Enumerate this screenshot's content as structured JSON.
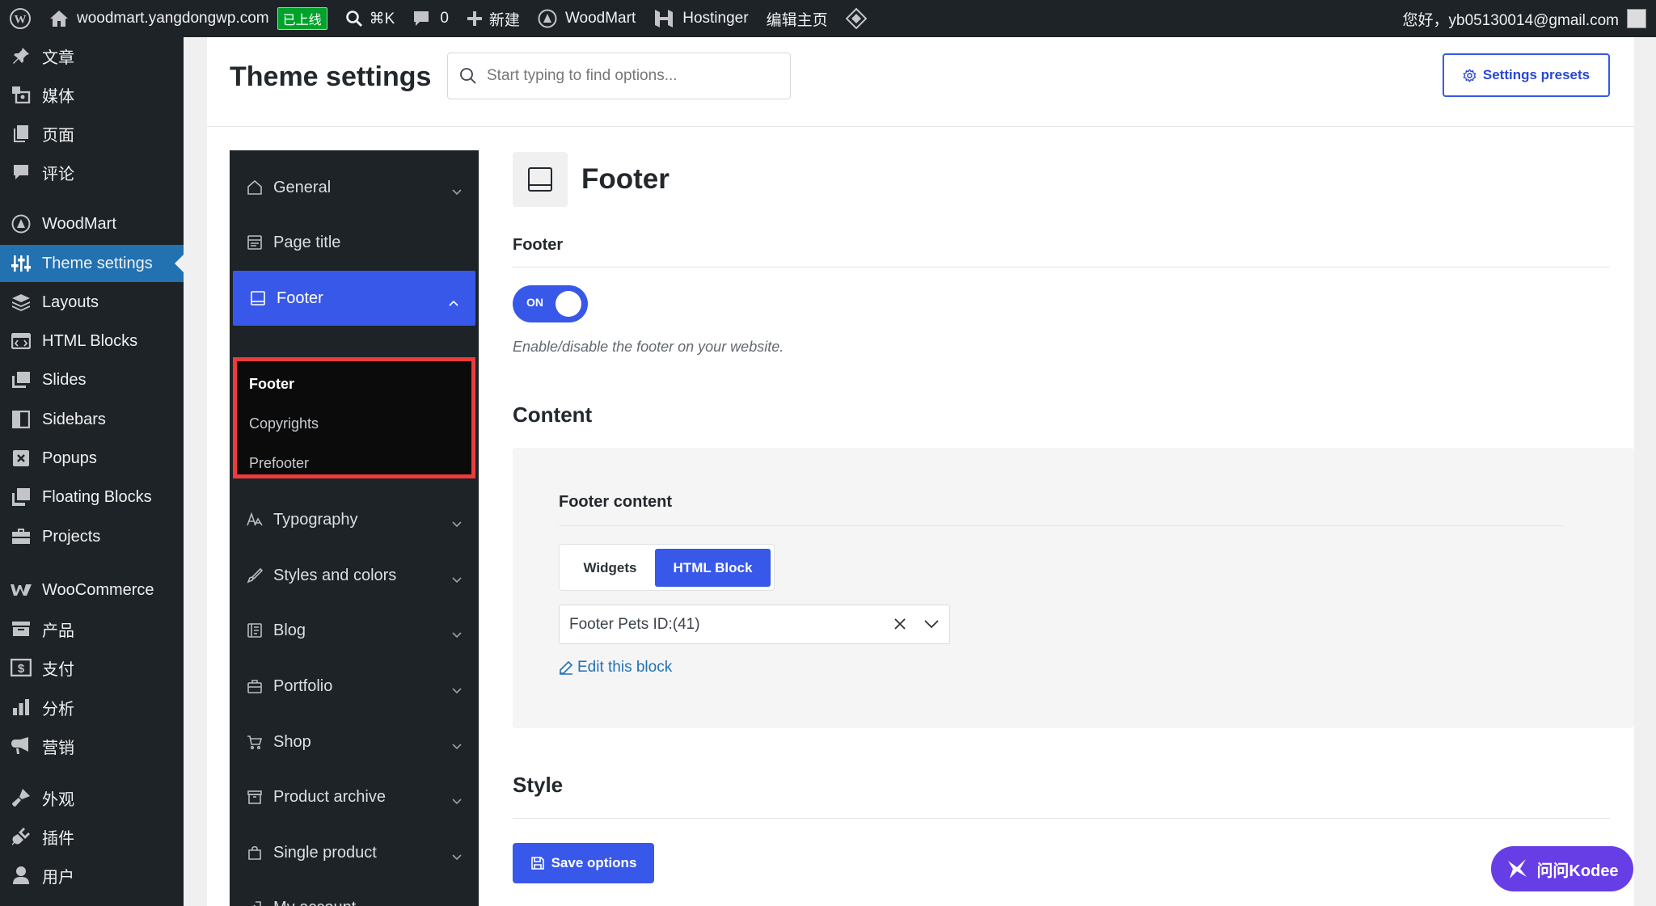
{
  "adminbar": {
    "site_name": "woodmart.yangdongwp.com",
    "live_badge": "已上线",
    "shortcut": "⌘K",
    "comments_count": "0",
    "new_label": "新建",
    "woodmart_label": "WoodMart",
    "hostinger_label": "Hostinger",
    "edit_home": "编辑主页",
    "greeting": "您好，yb05130014@gmail.com"
  },
  "menu": {
    "items": [
      {
        "label": "文章",
        "icon": "pin-icon"
      },
      {
        "label": "媒体",
        "icon": "media-icon"
      },
      {
        "label": "页面",
        "icon": "pages-icon"
      },
      {
        "label": "评论",
        "icon": "comments-icon"
      },
      {
        "label": "WoodMart",
        "icon": "woodmart-icon"
      },
      {
        "label": "Theme settings",
        "icon": "sliders-icon"
      },
      {
        "label": "Layouts",
        "icon": "layers-icon"
      },
      {
        "label": "HTML Blocks",
        "icon": "html-block-icon"
      },
      {
        "label": "Slides",
        "icon": "slides-icon"
      },
      {
        "label": "Sidebars",
        "icon": "sidebar-icon"
      },
      {
        "label": "Popups",
        "icon": "popup-icon"
      },
      {
        "label": "Floating Blocks",
        "icon": "floating-icon"
      },
      {
        "label": "Projects",
        "icon": "briefcase-icon"
      },
      {
        "label": "WooCommerce",
        "icon": "woocommerce-icon"
      },
      {
        "label": "产品",
        "icon": "archive-icon"
      },
      {
        "label": "支付",
        "icon": "dollar-icon"
      },
      {
        "label": "分析",
        "icon": "chart-icon"
      },
      {
        "label": "营销",
        "icon": "megaphone-icon"
      },
      {
        "label": "外观",
        "icon": "brush-icon"
      },
      {
        "label": "插件",
        "icon": "plugin-icon"
      },
      {
        "label": "用户",
        "icon": "user-icon"
      }
    ]
  },
  "header": {
    "title": "Theme settings",
    "search_placeholder": "Start typing to find options...",
    "presets_label": "Settings presets"
  },
  "settings_nav": {
    "items": [
      {
        "label": "General"
      },
      {
        "label": "Page title"
      },
      {
        "label": "Footer"
      },
      {
        "label": "Typography"
      },
      {
        "label": "Styles and colors"
      },
      {
        "label": "Blog"
      },
      {
        "label": "Portfolio"
      },
      {
        "label": "Shop"
      },
      {
        "label": "Product archive"
      },
      {
        "label": "Single product"
      },
      {
        "label": "My account"
      }
    ],
    "footer_sub": [
      "Footer",
      "Copyrights",
      "Prefooter"
    ]
  },
  "section": {
    "title": "Footer",
    "footer_field_label": "Footer",
    "toggle_text": "ON",
    "toggle_value": true,
    "help_text": "Enable/disable the footer on your website.",
    "content_title": "Content",
    "footer_content_label": "Footer content",
    "content_options": [
      "Widgets",
      "HTML Block"
    ],
    "selected_option": "HTML Block",
    "select_value": "Footer Pets ID:(41)",
    "edit_link": "Edit this block",
    "style_title": "Style",
    "save_label": "Save options"
  },
  "kodee_label": "问问Kodee",
  "colors": {
    "accent": "#3858e9",
    "admin_bg": "#1d2327",
    "wp_blue": "#2271b1",
    "highlight_border": "#ed3b3b",
    "kodee": "#673de6"
  }
}
